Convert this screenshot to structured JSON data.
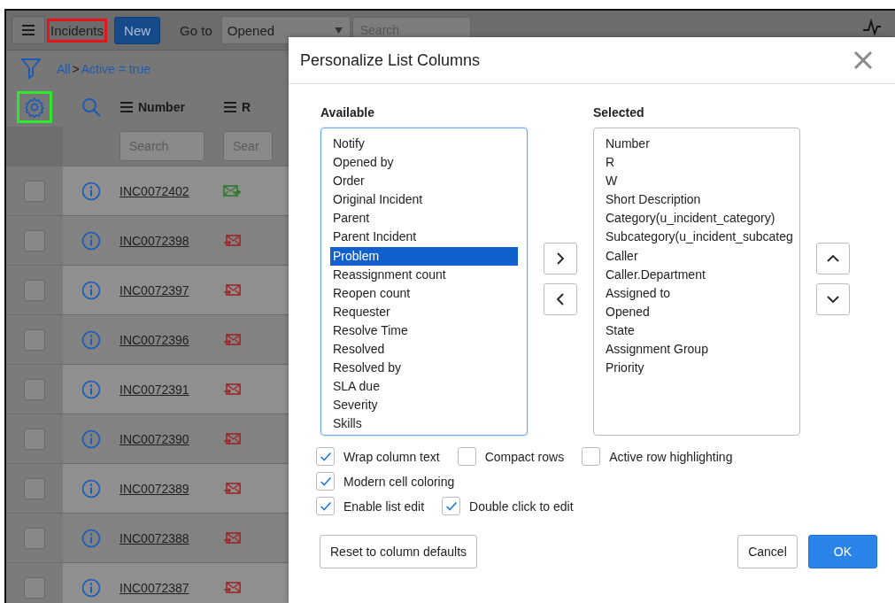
{
  "toolbar": {
    "module_title": {
      "text": "Incidents",
      "highlighted": true
    },
    "new_button": "New",
    "goto_label": "Go to",
    "goto_select": "Opened",
    "search": {
      "placeholder": "Search"
    }
  },
  "breadcrumb": [
    {
      "text": "All",
      "kind": "link"
    },
    {
      "text": ">",
      "kind": "separator"
    },
    {
      "text": "Active = true",
      "kind": "link"
    }
  ],
  "list": {
    "settings": {
      "highlighted": true
    },
    "columns": [
      {
        "label": "Number",
        "placeholder": "Search"
      },
      {
        "label": "R",
        "placeholder": "Sear"
      }
    ],
    "rows": [
      {
        "number": "INC0072402",
        "kind": "sent",
        "checked": false
      },
      {
        "number": "INC0072398",
        "kind": "received",
        "checked": false
      },
      {
        "number": "INC0072397",
        "kind": "received",
        "checked": false
      },
      {
        "number": "INC0072396",
        "kind": "received",
        "checked": false
      },
      {
        "number": "INC0072391",
        "kind": "received",
        "checked": false
      },
      {
        "number": "INC0072390",
        "kind": "received",
        "checked": false
      },
      {
        "number": "INC0072389",
        "kind": "received",
        "checked": false
      },
      {
        "number": "INC0072388",
        "kind": "received",
        "checked": false
      },
      {
        "number": "INC0072387",
        "kind": "received",
        "checked": false
      }
    ]
  },
  "dialog": {
    "title": "Personalize List Columns",
    "available": {
      "label": "Available",
      "items": [
        {
          "text": "Notify",
          "selected": false
        },
        {
          "text": "Opened by",
          "selected": false
        },
        {
          "text": "Order",
          "selected": false
        },
        {
          "text": "Original Incident",
          "selected": false
        },
        {
          "text": "Parent",
          "selected": false
        },
        {
          "text": "Parent Incident",
          "selected": false
        },
        {
          "text": "Problem",
          "selected": true
        },
        {
          "text": "Reassignment count",
          "selected": false
        },
        {
          "text": "Reopen count",
          "selected": false
        },
        {
          "text": "Requester",
          "selected": false
        },
        {
          "text": "Resolve Time",
          "selected": false
        },
        {
          "text": "Resolved",
          "selected": false
        },
        {
          "text": "Resolved by",
          "selected": false
        },
        {
          "text": "SLA due",
          "selected": false
        },
        {
          "text": "Severity",
          "selected": false
        },
        {
          "text": "Skills",
          "selected": false
        }
      ]
    },
    "selected": {
      "label": "Selected",
      "items": [
        {
          "text": "Number",
          "selected": false
        },
        {
          "text": "R",
          "selected": false
        },
        {
          "text": "W",
          "selected": false
        },
        {
          "text": "Short Description",
          "selected": false
        },
        {
          "text": "Category(u_incident_category)",
          "selected": false
        },
        {
          "text": "Subcategory(u_incident_subcateg",
          "selected": false
        },
        {
          "text": "Caller",
          "selected": false
        },
        {
          "text": "Caller.Department",
          "selected": false
        },
        {
          "text": "Assigned to",
          "selected": false
        },
        {
          "text": "Opened",
          "selected": false
        },
        {
          "text": "State",
          "selected": false
        },
        {
          "text": "Assignment Group",
          "selected": false
        },
        {
          "text": "Priority",
          "selected": false
        }
      ]
    },
    "option_rows": [
      [
        {
          "label": "Wrap column text",
          "checked": true
        },
        {
          "label": "Compact rows",
          "checked": false
        },
        {
          "label": "Active row highlighting",
          "checked": false
        }
      ],
      [
        {
          "label": "Modern cell coloring",
          "checked": true
        }
      ],
      [
        {
          "label": "Enable list edit",
          "checked": true
        },
        {
          "label": "Double click to edit",
          "checked": true
        }
      ]
    ],
    "buttons": [
      {
        "label": "Reset to column defaults",
        "kind": "secondary"
      },
      {
        "label": "Cancel",
        "kind": "secondary"
      },
      {
        "label": "OK",
        "kind": "primary"
      }
    ]
  }
}
